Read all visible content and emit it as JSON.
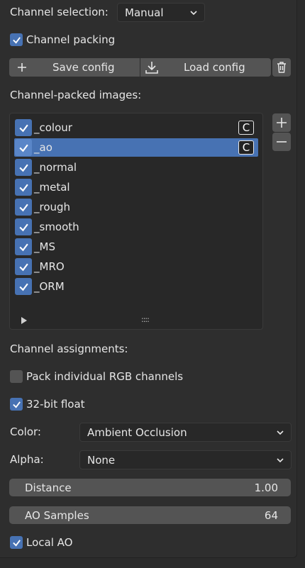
{
  "channel_selection": {
    "label": "Channel selection:",
    "value": "Manual"
  },
  "channel_packing": {
    "label": "Channel packing",
    "checked": true
  },
  "config_buttons": {
    "save": "Save config",
    "load": "Load config"
  },
  "packed_images_label": "Channel-packed images:",
  "packed_images": [
    {
      "name": "_colour",
      "checked": true,
      "badge": "C",
      "selected": false
    },
    {
      "name": "_ao",
      "checked": true,
      "badge": "C",
      "selected": true
    },
    {
      "name": "_normal",
      "checked": true,
      "badge": "",
      "selected": false
    },
    {
      "name": "_metal",
      "checked": true,
      "badge": "",
      "selected": false
    },
    {
      "name": "_rough",
      "checked": true,
      "badge": "",
      "selected": false
    },
    {
      "name": "_smooth",
      "checked": true,
      "badge": "",
      "selected": false
    },
    {
      "name": "_MS",
      "checked": true,
      "badge": "",
      "selected": false
    },
    {
      "name": "_MRO",
      "checked": true,
      "badge": "",
      "selected": false
    },
    {
      "name": "_ORM",
      "checked": true,
      "badge": "",
      "selected": false
    }
  ],
  "list_footer": {
    "grip": "::::"
  },
  "channel_assignments_label": "Channel assignments:",
  "pack_rgb": {
    "label": "Pack individual RGB channels",
    "checked": false
  },
  "float32": {
    "label": "32-bit float",
    "checked": true
  },
  "color": {
    "label": "Color:",
    "value": "Ambient Occlusion"
  },
  "alpha": {
    "label": "Alpha:",
    "value": "None"
  },
  "distance": {
    "label": "Distance",
    "value": "1.00"
  },
  "ao_samples": {
    "label": "AO Samples",
    "value": "64"
  },
  "local_ao": {
    "label": "Local AO",
    "checked": true
  },
  "colors": {
    "accent": "#4772b3",
    "panel": "#2e2e2e",
    "field": "#282828",
    "button": "#545454"
  }
}
